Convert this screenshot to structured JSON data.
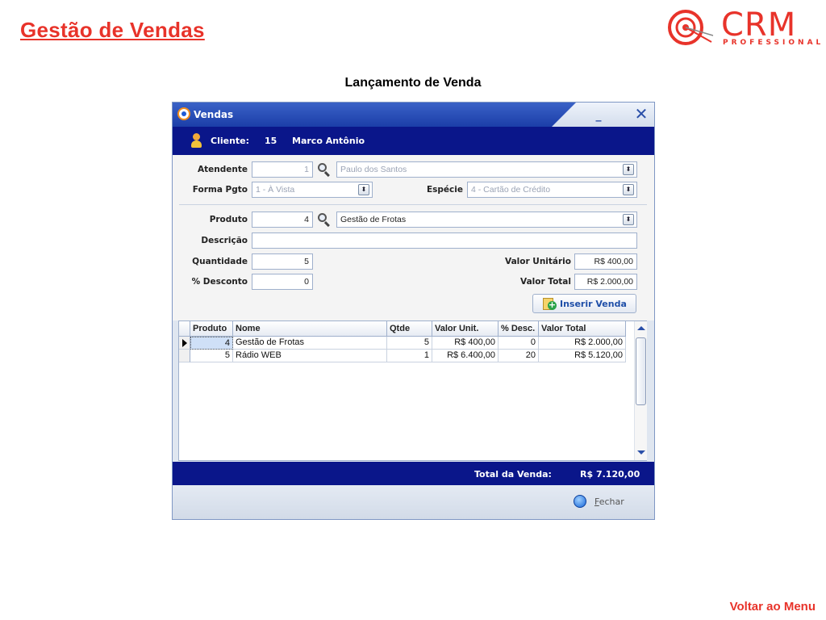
{
  "slide": {
    "title": "Gestão de Vendas",
    "subtitle": "Lançamento de Venda",
    "footer_link": "Voltar ao Menu",
    "logo_text": "CRM",
    "logo_subtext": "PROFESSIONAL"
  },
  "window": {
    "title": "Vendas",
    "minimize_label": "_",
    "close_label": "✕"
  },
  "client": {
    "label": "Cliente:",
    "id": "15",
    "name": "Marco Antônio"
  },
  "form": {
    "atendente_label": "Atendente",
    "atendente_code": "1",
    "atendente_name": "Paulo dos Santos",
    "forma_pgto_label": "Forma Pgto",
    "forma_pgto_value": "1 - À Vista",
    "especie_label": "Espécie",
    "especie_value": "4 - Cartão de Crédito",
    "produto_label": "Produto",
    "produto_code": "4",
    "produto_name": "Gestão de Frotas",
    "descricao_label": "Descrição",
    "descricao_value": "",
    "quantidade_label": "Quantidade",
    "quantidade_value": "5",
    "desconto_label": "% Desconto",
    "desconto_value": "0",
    "valor_unitario_label": "Valor Unitário",
    "valor_unitario_value": "R$ 400,00",
    "valor_total_label": "Valor Total",
    "valor_total_value": "R$ 2.000,00",
    "insert_button": "Inserir Venda"
  },
  "grid": {
    "columns": [
      "Produto",
      "Nome",
      "Qtde",
      "Valor Unit.",
      "% Desc.",
      "Valor Total"
    ],
    "rows": [
      [
        "4",
        "Gestão de Frotas",
        "5",
        "R$ 400,00",
        "0",
        "R$ 2.000,00"
      ],
      [
        "5",
        "Rádio WEB",
        "1",
        "R$ 6.400,00",
        "20",
        "R$ 5.120,00"
      ]
    ]
  },
  "totals": {
    "label": "Total da Venda:",
    "value": "R$ 7.120,00"
  },
  "footer": {
    "close_button_first": "F",
    "close_button_rest": "echar"
  }
}
